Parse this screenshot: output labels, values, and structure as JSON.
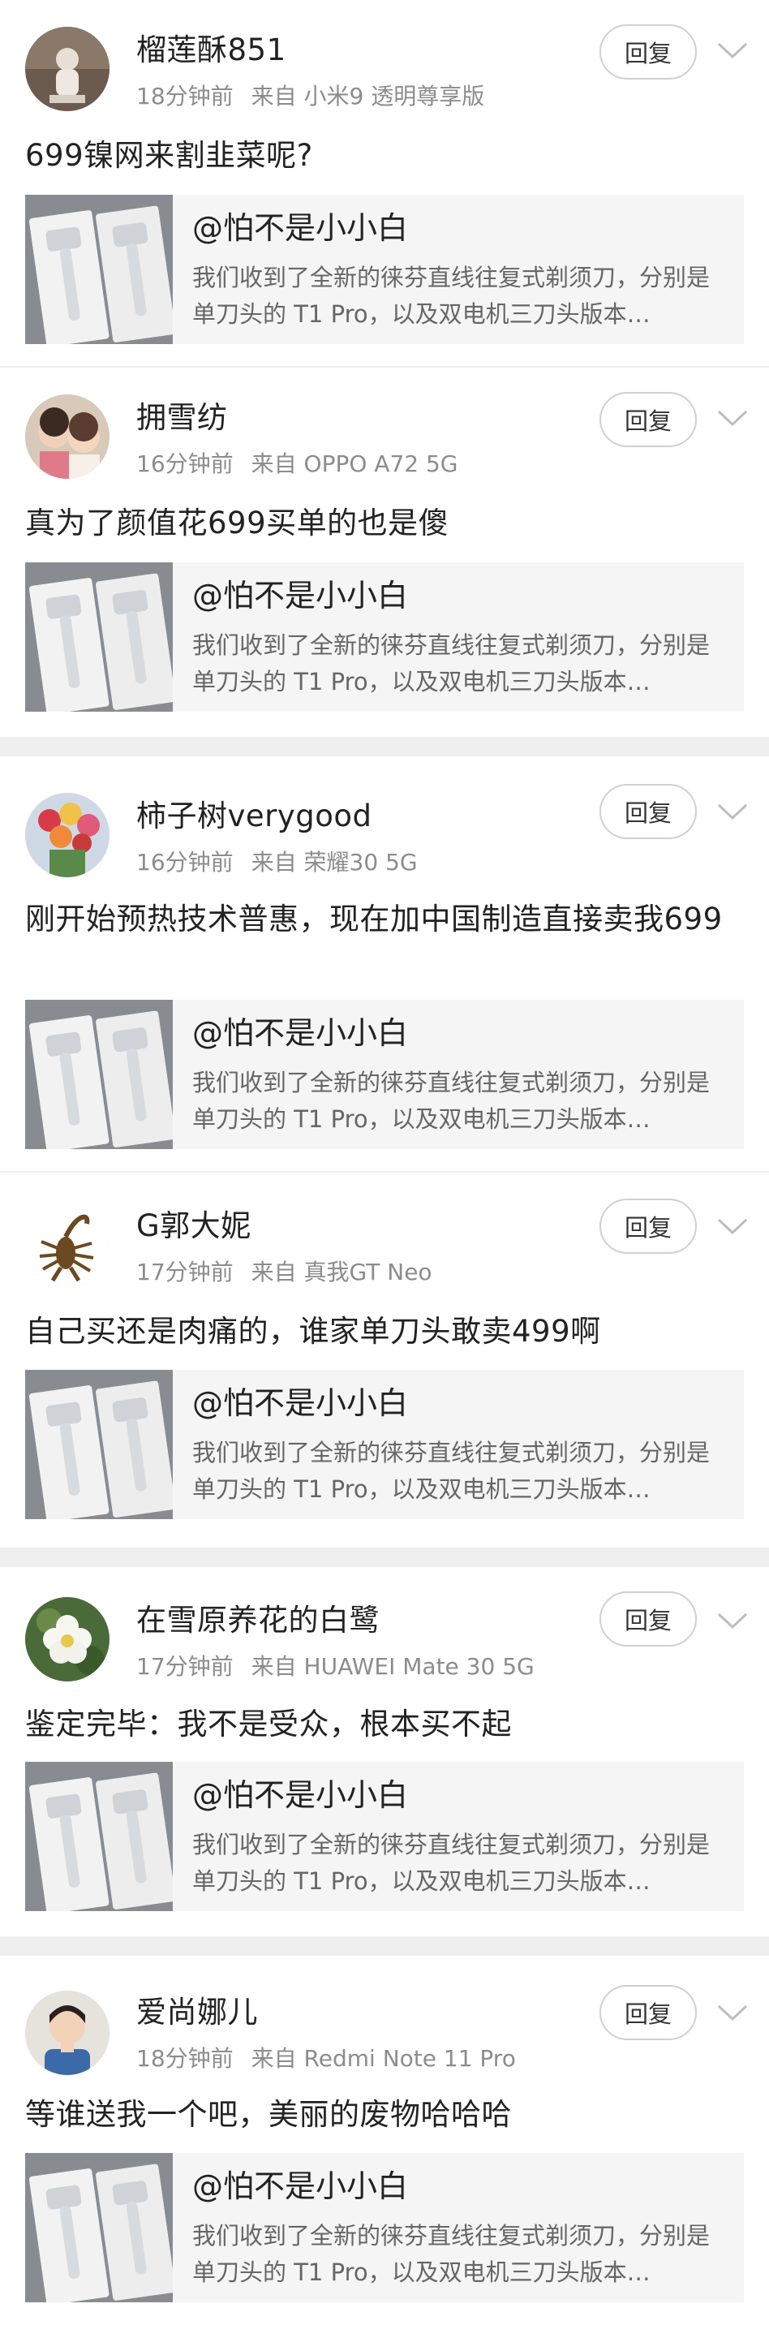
{
  "reply_label": "回复",
  "quote": {
    "mention": "@怕不是小小白",
    "text": "我们收到了全新的徕芬直线往复式剃须刀，分别是单刀头的 T1 Pro，以及双电机三刀头版本…"
  },
  "comments": [
    {
      "username": "榴莲酥851",
      "time": "18分钟前",
      "source": "来自 小米9 透明尊享版",
      "body": "699镍网来割韭菜呢?",
      "avatar_icon": "figurine-avatar-icon"
    },
    {
      "username": "拥雪纺",
      "time": "16分钟前",
      "source": "来自 OPPO A72 5G",
      "body": "真为了颜值花699买单的也是傻",
      "avatar_icon": "kids-photo-avatar-icon"
    },
    {
      "username": "柿子树verygood",
      "time": "16分钟前",
      "source": "来自 荣耀30 5G",
      "body": "刚开始预热技术普惠，现在加中国制造直接卖我699",
      "avatar_icon": "flower-bouquet-avatar-icon"
    },
    {
      "username": "G郭大妮",
      "time": "17分钟前",
      "source": "来自 真我GT Neo",
      "body": "自己买还是肉痛的，谁家单刀头敢卖499啊",
      "avatar_icon": "scorpion-avatar-icon"
    },
    {
      "username": "在雪原养花的白鹭",
      "time": "17分钟前",
      "source": "来自 HUAWEI Mate 30 5G",
      "body": "鉴定完毕：我不是受众，根本买不起",
      "avatar_icon": "white-flower-avatar-icon"
    },
    {
      "username": "爱尚娜儿",
      "time": "18分钟前",
      "source": "来自 Redmi Note 11 Pro",
      "body": "等谁送我一个吧，美丽的废物哈哈哈",
      "avatar_icon": "person-portrait-avatar-icon"
    }
  ]
}
